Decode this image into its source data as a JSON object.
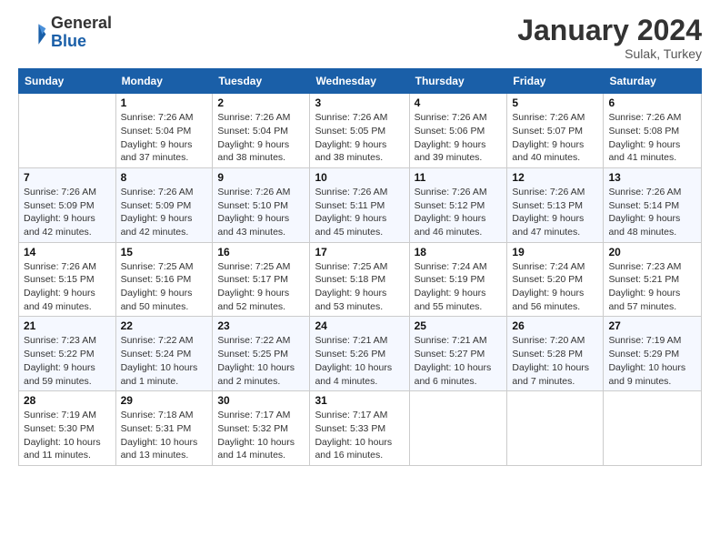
{
  "header": {
    "logo_general": "General",
    "logo_blue": "Blue",
    "month": "January 2024",
    "location": "Sulak, Turkey"
  },
  "days_of_week": [
    "Sunday",
    "Monday",
    "Tuesday",
    "Wednesday",
    "Thursday",
    "Friday",
    "Saturday"
  ],
  "weeks": [
    [
      {
        "day": "",
        "info": ""
      },
      {
        "day": "1",
        "info": "Sunrise: 7:26 AM\nSunset: 5:04 PM\nDaylight: 9 hours\nand 37 minutes."
      },
      {
        "day": "2",
        "info": "Sunrise: 7:26 AM\nSunset: 5:04 PM\nDaylight: 9 hours\nand 38 minutes."
      },
      {
        "day": "3",
        "info": "Sunrise: 7:26 AM\nSunset: 5:05 PM\nDaylight: 9 hours\nand 38 minutes."
      },
      {
        "day": "4",
        "info": "Sunrise: 7:26 AM\nSunset: 5:06 PM\nDaylight: 9 hours\nand 39 minutes."
      },
      {
        "day": "5",
        "info": "Sunrise: 7:26 AM\nSunset: 5:07 PM\nDaylight: 9 hours\nand 40 minutes."
      },
      {
        "day": "6",
        "info": "Sunrise: 7:26 AM\nSunset: 5:08 PM\nDaylight: 9 hours\nand 41 minutes."
      }
    ],
    [
      {
        "day": "7",
        "info": "Sunrise: 7:26 AM\nSunset: 5:09 PM\nDaylight: 9 hours\nand 42 minutes."
      },
      {
        "day": "8",
        "info": "Sunrise: 7:26 AM\nSunset: 5:09 PM\nDaylight: 9 hours\nand 42 minutes."
      },
      {
        "day": "9",
        "info": "Sunrise: 7:26 AM\nSunset: 5:10 PM\nDaylight: 9 hours\nand 43 minutes."
      },
      {
        "day": "10",
        "info": "Sunrise: 7:26 AM\nSunset: 5:11 PM\nDaylight: 9 hours\nand 45 minutes."
      },
      {
        "day": "11",
        "info": "Sunrise: 7:26 AM\nSunset: 5:12 PM\nDaylight: 9 hours\nand 46 minutes."
      },
      {
        "day": "12",
        "info": "Sunrise: 7:26 AM\nSunset: 5:13 PM\nDaylight: 9 hours\nand 47 minutes."
      },
      {
        "day": "13",
        "info": "Sunrise: 7:26 AM\nSunset: 5:14 PM\nDaylight: 9 hours\nand 48 minutes."
      }
    ],
    [
      {
        "day": "14",
        "info": "Sunrise: 7:26 AM\nSunset: 5:15 PM\nDaylight: 9 hours\nand 49 minutes."
      },
      {
        "day": "15",
        "info": "Sunrise: 7:25 AM\nSunset: 5:16 PM\nDaylight: 9 hours\nand 50 minutes."
      },
      {
        "day": "16",
        "info": "Sunrise: 7:25 AM\nSunset: 5:17 PM\nDaylight: 9 hours\nand 52 minutes."
      },
      {
        "day": "17",
        "info": "Sunrise: 7:25 AM\nSunset: 5:18 PM\nDaylight: 9 hours\nand 53 minutes."
      },
      {
        "day": "18",
        "info": "Sunrise: 7:24 AM\nSunset: 5:19 PM\nDaylight: 9 hours\nand 55 minutes."
      },
      {
        "day": "19",
        "info": "Sunrise: 7:24 AM\nSunset: 5:20 PM\nDaylight: 9 hours\nand 56 minutes."
      },
      {
        "day": "20",
        "info": "Sunrise: 7:23 AM\nSunset: 5:21 PM\nDaylight: 9 hours\nand 57 minutes."
      }
    ],
    [
      {
        "day": "21",
        "info": "Sunrise: 7:23 AM\nSunset: 5:22 PM\nDaylight: 9 hours\nand 59 minutes."
      },
      {
        "day": "22",
        "info": "Sunrise: 7:22 AM\nSunset: 5:24 PM\nDaylight: 10 hours\nand 1 minute."
      },
      {
        "day": "23",
        "info": "Sunrise: 7:22 AM\nSunset: 5:25 PM\nDaylight: 10 hours\nand 2 minutes."
      },
      {
        "day": "24",
        "info": "Sunrise: 7:21 AM\nSunset: 5:26 PM\nDaylight: 10 hours\nand 4 minutes."
      },
      {
        "day": "25",
        "info": "Sunrise: 7:21 AM\nSunset: 5:27 PM\nDaylight: 10 hours\nand 6 minutes."
      },
      {
        "day": "26",
        "info": "Sunrise: 7:20 AM\nSunset: 5:28 PM\nDaylight: 10 hours\nand 7 minutes."
      },
      {
        "day": "27",
        "info": "Sunrise: 7:19 AM\nSunset: 5:29 PM\nDaylight: 10 hours\nand 9 minutes."
      }
    ],
    [
      {
        "day": "28",
        "info": "Sunrise: 7:19 AM\nSunset: 5:30 PM\nDaylight: 10 hours\nand 11 minutes."
      },
      {
        "day": "29",
        "info": "Sunrise: 7:18 AM\nSunset: 5:31 PM\nDaylight: 10 hours\nand 13 minutes."
      },
      {
        "day": "30",
        "info": "Sunrise: 7:17 AM\nSunset: 5:32 PM\nDaylight: 10 hours\nand 14 minutes."
      },
      {
        "day": "31",
        "info": "Sunrise: 7:17 AM\nSunset: 5:33 PM\nDaylight: 10 hours\nand 16 minutes."
      },
      {
        "day": "",
        "info": ""
      },
      {
        "day": "",
        "info": ""
      },
      {
        "day": "",
        "info": ""
      }
    ]
  ]
}
